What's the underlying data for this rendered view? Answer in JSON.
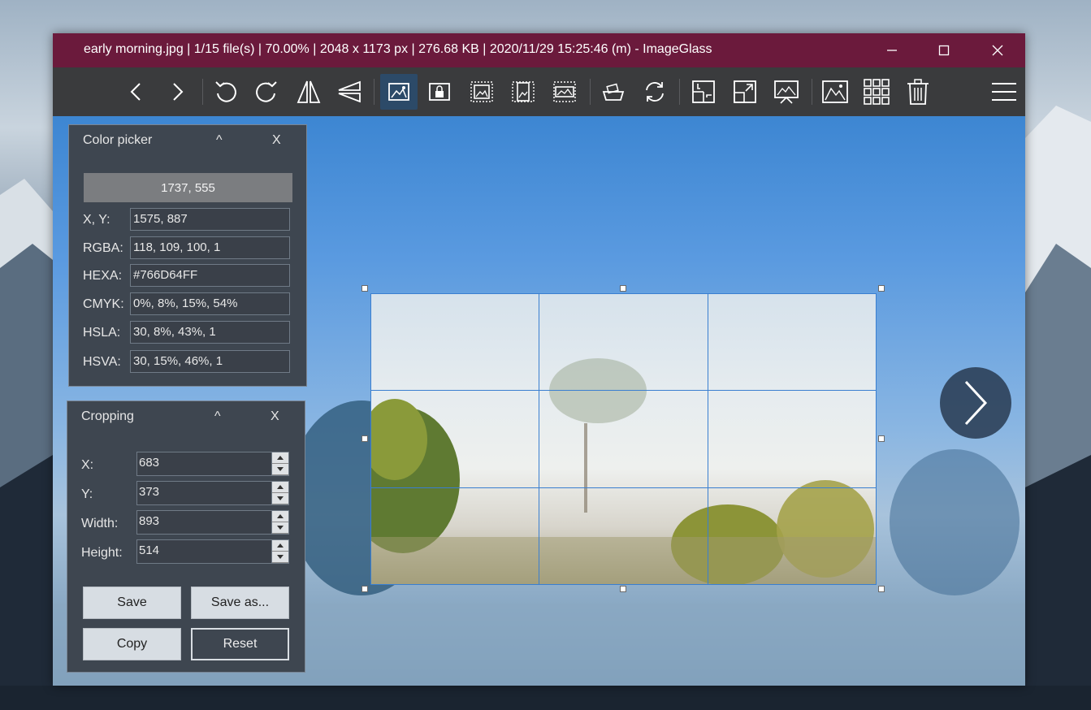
{
  "window": {
    "title": "early morning.jpg  |  1/15 file(s)  |  70.00%  |  2048 x 1173 px  |  276.68 KB  |  2020/11/29 15:25:46 (m)  - ImageGlass",
    "title_bar_color": "#6b1a3c"
  },
  "window_controls": [
    "minimize-icon",
    "maximize-icon",
    "close-icon"
  ],
  "toolbar": {
    "icons": [
      "previous-icon",
      "next-icon",
      "rotate-left-icon",
      "rotate-right-icon",
      "flip-horizontal-icon",
      "flip-vertical-icon",
      "crop-tool-icon",
      "lock-zoom-icon",
      "zoom-fit-icon",
      "zoom-width-icon",
      "zoom-height-icon",
      "print-icon",
      "refresh-icon",
      "auto-size-icon",
      "fullscreen-icon",
      "slideshow-icon",
      "wallpaper-icon",
      "thumbnails-icon",
      "delete-icon",
      "menu-icon"
    ],
    "active": "crop-tool-icon"
  },
  "color_picker": {
    "title": "Color picker",
    "collapse": "^",
    "close": "X",
    "cursor_coords": "1737, 555",
    "rows": [
      {
        "label": "X, Y:",
        "value": "1575, 887"
      },
      {
        "label": "RGBA:",
        "value": "118, 109, 100, 1"
      },
      {
        "label": "HEXA:",
        "value": "#766D64FF"
      },
      {
        "label": "CMYK:",
        "value": "0%, 8%, 15%, 54%"
      },
      {
        "label": "HSLA:",
        "value": "30, 8%, 43%, 1"
      },
      {
        "label": "HSVA:",
        "value": "30, 15%, 46%, 1"
      }
    ]
  },
  "cropping": {
    "title": "Cropping",
    "collapse": "^",
    "close": "X",
    "fields": [
      {
        "label": "X:",
        "value": "683"
      },
      {
        "label": "Y:",
        "value": "373"
      },
      {
        "label": "Width:",
        "value": "893"
      },
      {
        "label": "Height:",
        "value": "514"
      }
    ],
    "buttons": {
      "save": "Save",
      "save_as": "Save as...",
      "copy": "Copy",
      "reset": "Reset"
    }
  },
  "viewer": {
    "next_icon": "chevron-right-icon",
    "accent": "#3a7fd0"
  }
}
